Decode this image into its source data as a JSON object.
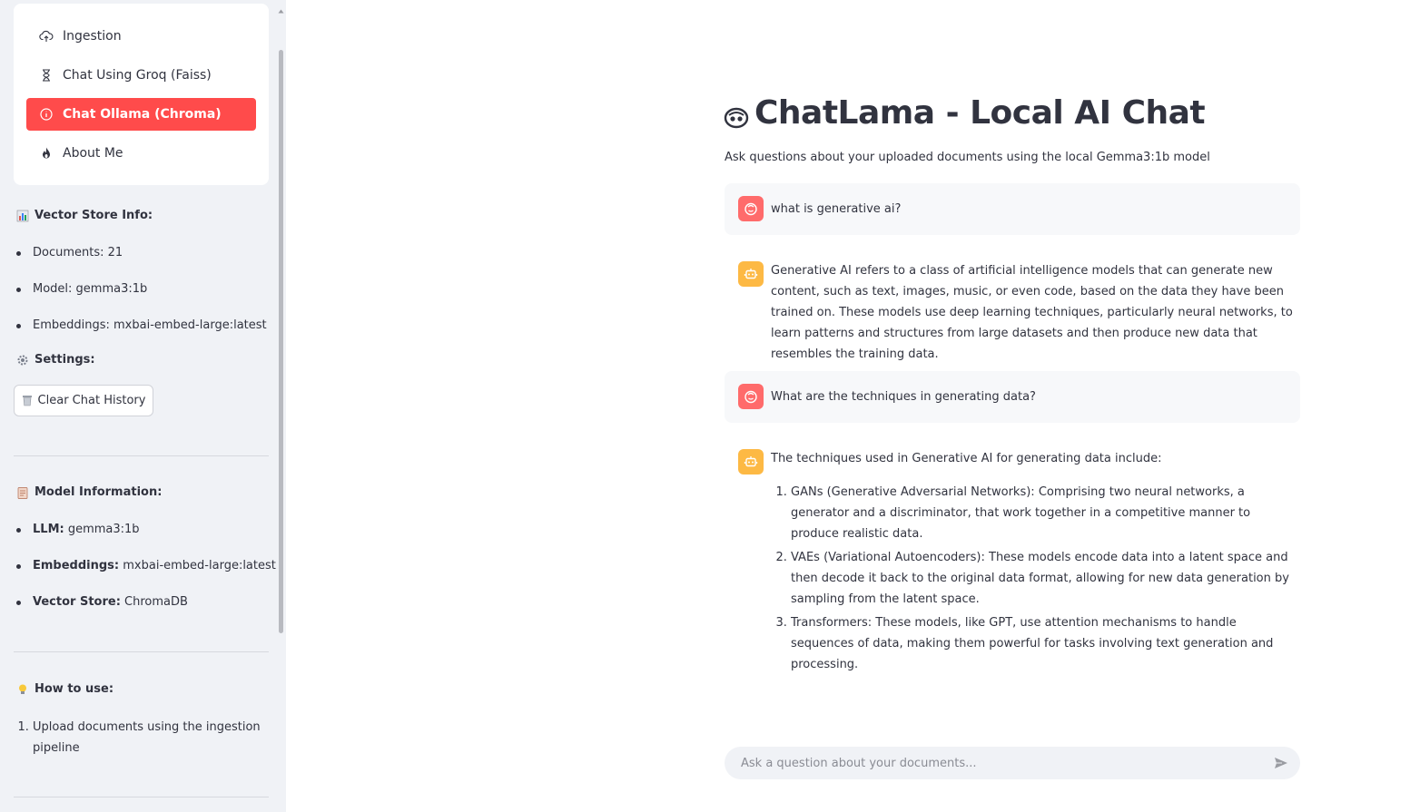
{
  "sidebar": {
    "nav": [
      {
        "label": "Ingestion",
        "icon": "cloud-upload-icon",
        "active": false
      },
      {
        "label": "Chat Using Groq (Faiss)",
        "icon": "hourglass-icon",
        "active": false
      },
      {
        "label": "Chat Ollama (Chroma)",
        "icon": "info-circle-icon",
        "active": true
      },
      {
        "label": "About Me",
        "icon": "flame-icon",
        "active": false
      }
    ],
    "vector_store": {
      "heading": "Vector Store Info:",
      "items": [
        "Documents: 21",
        "Model: gemma3:1b",
        "Embeddings: mxbai-embed-large:latest"
      ]
    },
    "settings": {
      "heading": "Settings:",
      "clear_button": "Clear Chat History"
    },
    "model_info": {
      "heading": "Model Information:",
      "items": [
        {
          "key": "LLM:",
          "value": "gemma3:1b"
        },
        {
          "key": "Embeddings:",
          "value": "mxbai-embed-large:latest"
        },
        {
          "key": "Vector Store:",
          "value": "ChromaDB"
        }
      ]
    },
    "how_to": {
      "heading": "How to use:",
      "steps": [
        "Upload documents using the ingestion pipeline"
      ]
    }
  },
  "main": {
    "title": "ChatLama - Local AI Chat",
    "subtitle": "Ask questions about your uploaded documents using the local Gemma3:1b model",
    "messages": [
      {
        "role": "user",
        "text": "what is generative ai?"
      },
      {
        "role": "assistant",
        "text": "Generative AI refers to a class of artificial intelligence models that can generate new content, such as text, images, music, or even code, based on the data they have been trained on. These models use deep learning techniques, particularly neural networks, to learn patterns and structures from large datasets and then produce new data that resembles the training data."
      },
      {
        "role": "user",
        "text": "What are the techniques in generating data?"
      },
      {
        "role": "assistant",
        "text": "The techniques used in Generative AI for generating data include:",
        "list": [
          "GANs (Generative Adversarial Networks): Comprising two neural networks, a generator and a discriminator, that work together in a competitive manner to produce realistic data.",
          "VAEs (Variational Autoencoders): These models encode data into a latent space and then decode it back to the original data format, allowing for new data generation by sampling from the latent space.",
          "Transformers: These models, like GPT, use attention mechanisms to handle sequences of data, making them powerful for tasks involving text generation and processing."
        ]
      }
    ],
    "input_placeholder": "Ask a question about your documents..."
  },
  "colors": {
    "accent": "#ff4b4b",
    "user_avatar": "#ff6b6b",
    "bot_avatar": "#fdb944",
    "sidebar_bg": "#f0f2f6"
  }
}
